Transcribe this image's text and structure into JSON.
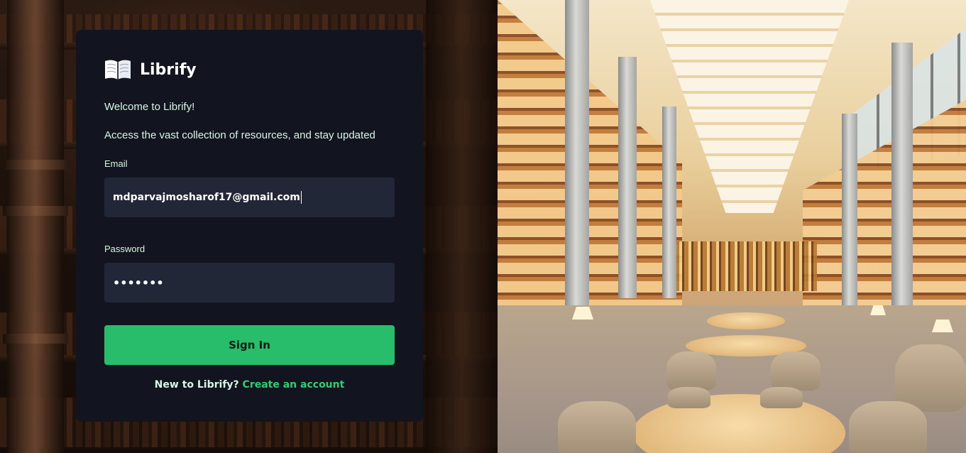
{
  "brand": {
    "name": "Librify",
    "icon": "open-book-icon"
  },
  "intro": {
    "welcome": "Welcome to Librify!",
    "tagline": "Access the vast collection of resources, and stay updated"
  },
  "form": {
    "email": {
      "label": "Email",
      "value": "mdparvajmosharof17@gmail.com"
    },
    "password": {
      "label": "Password",
      "value": "•••••••"
    },
    "submit_label": "Sign In"
  },
  "signup": {
    "prompt": "New to Librify?",
    "link_label": "Create an account"
  },
  "colors": {
    "card": "#12151f",
    "input": "#222738",
    "accent": "#27bd6a",
    "text": "#d7f7e5"
  }
}
